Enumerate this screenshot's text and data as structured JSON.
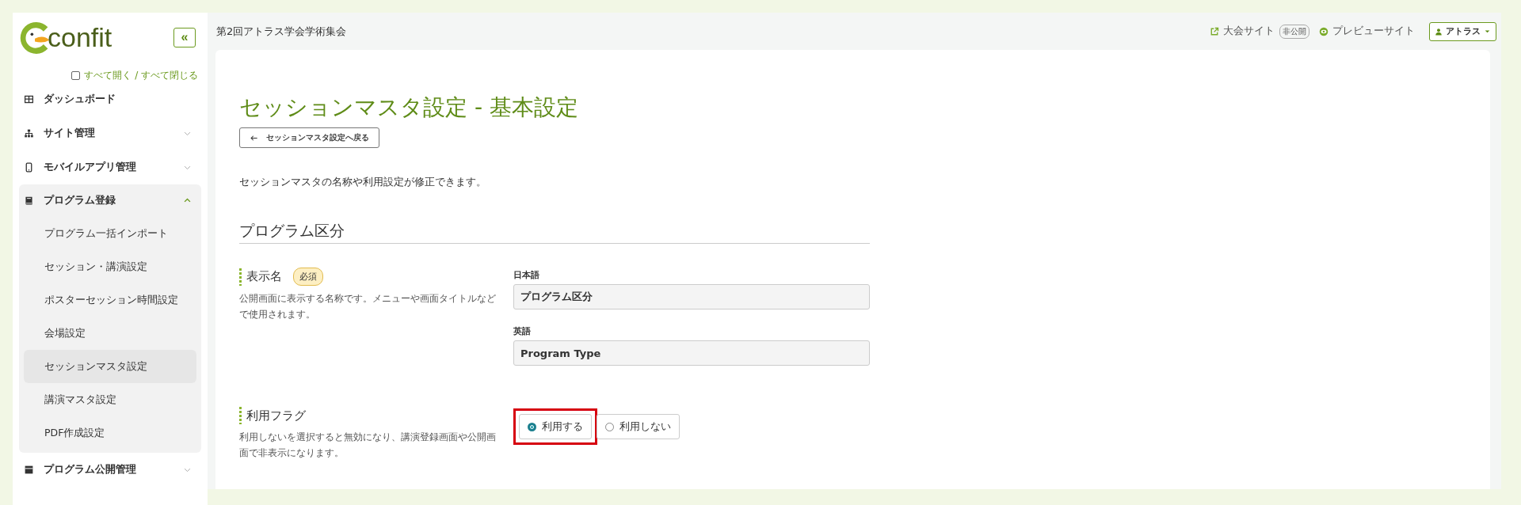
{
  "logo": {
    "text": "confit"
  },
  "sidebar": {
    "collapse_button": "«",
    "expand_all": {
      "label": "すべて開く / すべて閉じる",
      "checked": false
    },
    "items": [
      {
        "kind": "link",
        "label": "ダッシュボード"
      },
      {
        "kind": "group",
        "label": "サイト管理",
        "expanded": false
      },
      {
        "kind": "group",
        "label": "モバイルアプリ管理",
        "expanded": false
      },
      {
        "kind": "group",
        "label": "プログラム登録",
        "expanded": true,
        "children": [
          {
            "label": "プログラム一括インポート",
            "selected": false
          },
          {
            "label": "セッション・講演設定",
            "selected": false
          },
          {
            "label": "ポスターセッション時間設定",
            "selected": false
          },
          {
            "label": "会場設定",
            "selected": false
          },
          {
            "label": "セッションマスタ設定",
            "selected": true
          },
          {
            "label": "講演マスタ設定",
            "selected": false
          },
          {
            "label": "PDF作成設定",
            "selected": false
          }
        ]
      },
      {
        "kind": "group",
        "label": "プログラム公開管理",
        "expanded": false
      }
    ]
  },
  "header": {
    "event_title": "第2回アトラス学会学術集会",
    "site_link": {
      "label": "大会サイト",
      "badge": "非公開"
    },
    "preview_link": "プレビューサイト",
    "user_menu": "アトラス"
  },
  "page": {
    "title": "セッションマスタ設定 - 基本設定",
    "back_button": "セッションマスタ設定へ戻る",
    "description": "セッションマスタの名称や利用設定が修正できます。",
    "section_title": "プログラム区分",
    "fields": [
      {
        "kind": "text",
        "label": "表示名",
        "required_badge": "必須",
        "help": "公開画面に表示する名称です。メニューや画面タイトルなどで使用されます。",
        "inputs": [
          {
            "label": "日本語",
            "value": "プログラム区分"
          },
          {
            "label": "英語",
            "value": "Program Type"
          }
        ]
      },
      {
        "kind": "radio",
        "label": "利用フラグ",
        "help": "利用しないを選択すると無効になり、講演登録画面や公開画面で非表示になります。",
        "options": [
          {
            "label": "利用する",
            "selected": true,
            "highlighted": true
          },
          {
            "label": "利用しない",
            "selected": false,
            "highlighted": false
          }
        ]
      }
    ]
  }
}
